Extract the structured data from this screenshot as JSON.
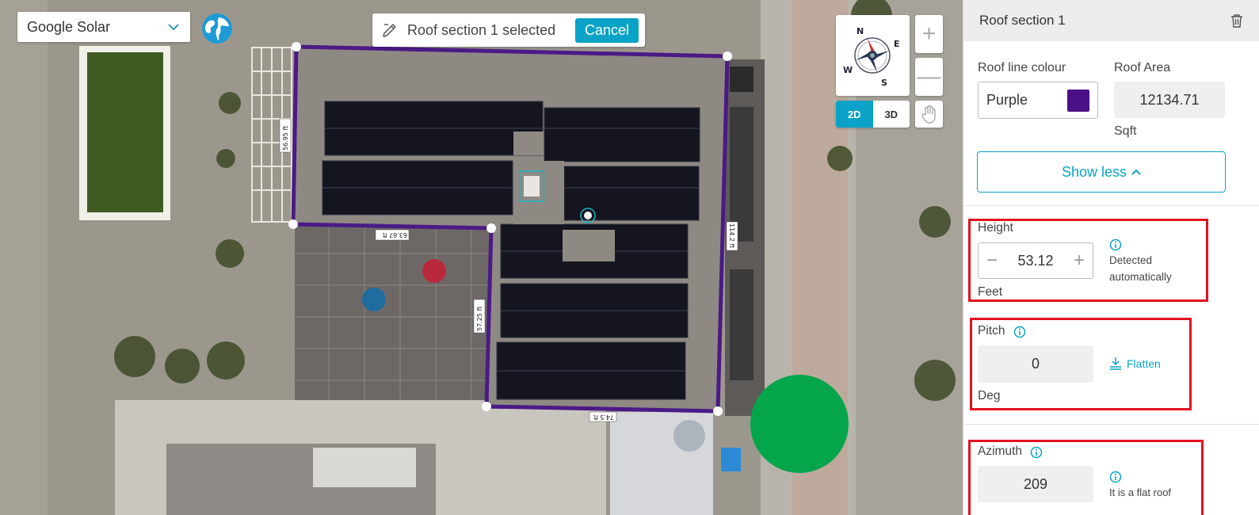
{
  "map": {
    "source_select_value": "Google Solar",
    "banner_text": "Roof section 1 selected",
    "cancel_label": "Cancel",
    "compass_letters": {
      "n": "N",
      "e": "E",
      "s": "S",
      "w": "W"
    },
    "view_2d": "2D",
    "view_3d": "3D",
    "active_view": "2D",
    "zoom_in": "+",
    "zoom_out": "—",
    "edge_labels": {
      "top_left": "56.95 ft",
      "inner_top": "63.67 ft",
      "right": "114.2 ft",
      "inner_left": "57.25 ft",
      "bottom": "74.5 ft"
    },
    "outline_color": "#4b1a86"
  },
  "panel": {
    "title": "Roof section 1",
    "roof_line_colour_label": "Roof line colour",
    "roof_line_colour_value": "Purple",
    "roof_line_colour_swatch": "#4b0f86",
    "roof_area_label": "Roof Area",
    "roof_area_value": "12134.71",
    "roof_area_unit": "Sqft",
    "show_less_label": "Show less",
    "height": {
      "label": "Height",
      "value": "53.12",
      "unit": "Feet",
      "note_line1": "Detected",
      "note_line2": "automatically"
    },
    "pitch": {
      "label": "Pitch",
      "value": "0",
      "unit": "Deg",
      "flatten_label": "Flatten"
    },
    "azimuth": {
      "label": "Azimuth",
      "value": "209",
      "note": "It is a flat roof"
    }
  },
  "colors": {
    "accent": "#0aa3c7",
    "highlight": "#e0131f",
    "marker": "#05a54c"
  }
}
